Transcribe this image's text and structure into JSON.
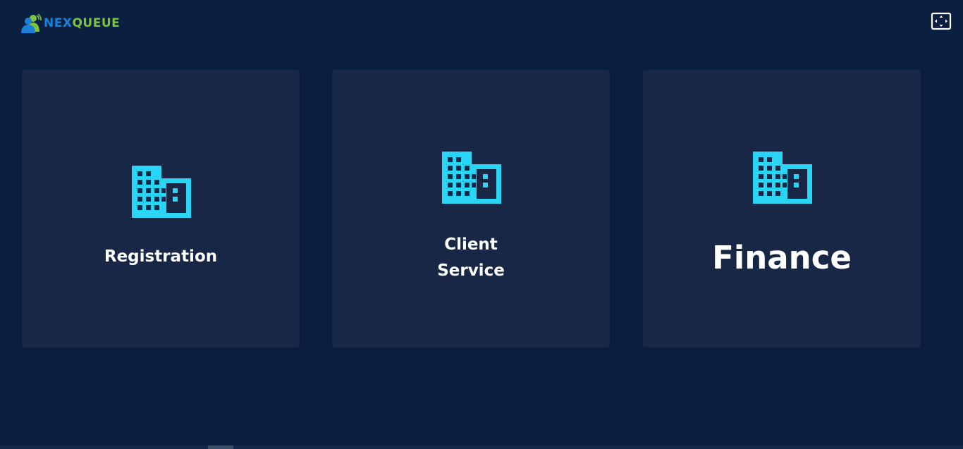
{
  "header": {
    "brand_prefix": "NEX",
    "brand_suffix": "QUEUE",
    "fullscreen_icon": "fullscreen-icon"
  },
  "cards": [
    {
      "label": "Registration",
      "icon": "building-icon"
    },
    {
      "label_line1": "Client",
      "label_line2": "Service",
      "icon": "building-icon"
    },
    {
      "label": "Finance",
      "icon": "building-icon"
    }
  ],
  "colors": {
    "background": "#0a1e3f",
    "card": "#172745",
    "icon_accent": "#29d4f5",
    "brand_blue": "#1c80d8",
    "brand_green": "#7dc242",
    "text": "#ffffff"
  }
}
